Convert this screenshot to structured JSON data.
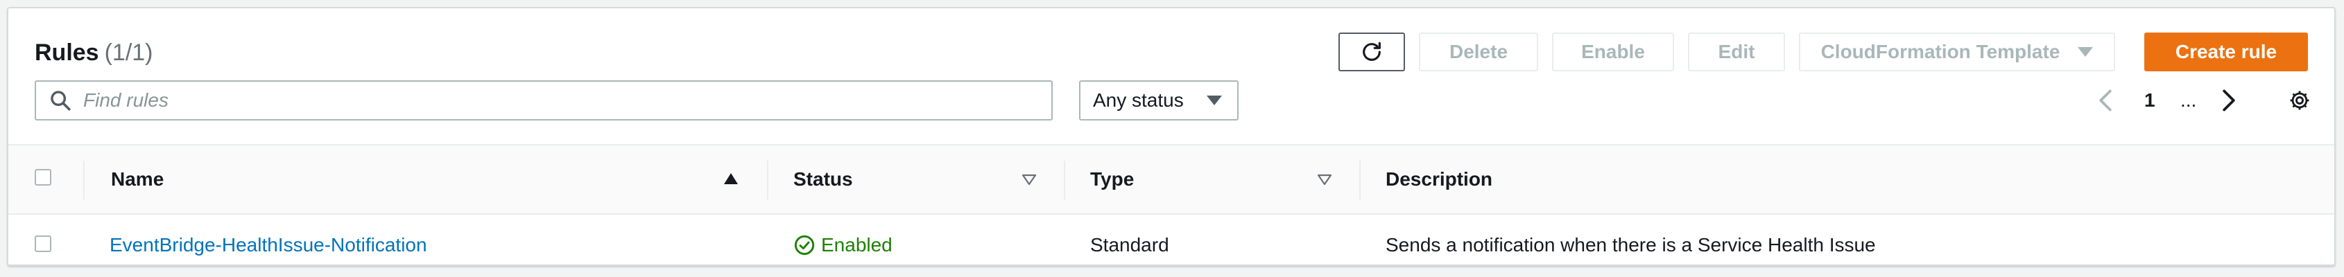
{
  "header": {
    "title": "Rules",
    "count": "(1/1)"
  },
  "toolbar": {
    "refresh_icon": "refresh-icon",
    "delete_label": "Delete",
    "enable_label": "Enable",
    "edit_label": "Edit",
    "cfn_label": "CloudFormation Template",
    "create_label": "Create rule"
  },
  "filter": {
    "search_placeholder": "Find rules",
    "status_value": "Any status"
  },
  "pagination": {
    "current_page": "1",
    "ellipsis": "...",
    "settings_icon": "gear-icon"
  },
  "table": {
    "columns": [
      "Name",
      "Status",
      "Type",
      "Description"
    ],
    "sort": {
      "column": "Name",
      "direction": "ascending"
    },
    "rows": [
      {
        "name": "EventBridge-HealthIssue-Notification",
        "status": "Enabled",
        "type": "Standard",
        "description": "Sends a notification when there is a Service Health Issue"
      }
    ]
  },
  "colors": {
    "primary": "#ec7211",
    "link": "#0073bb",
    "success": "#1d8102",
    "disabled": "#aab7b8"
  }
}
